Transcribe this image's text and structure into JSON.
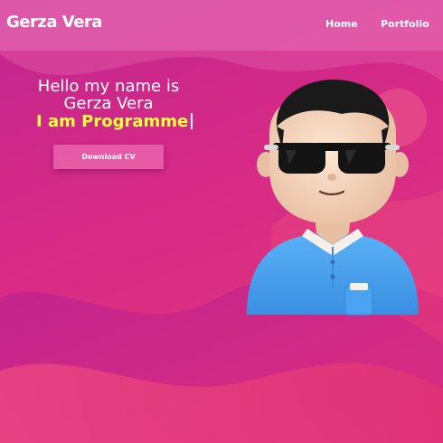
{
  "header": {
    "brand": "Gerza Vera",
    "nav": [
      {
        "label": "Home"
      },
      {
        "label": "Portfolio"
      }
    ]
  },
  "hero": {
    "greeting": "Hello my name is Gerza Vera",
    "role_text": "I am Programme",
    "download_label": "Download CV"
  },
  "colors": {
    "background_accent": "#d62a86",
    "role_text": "#f7ff3e",
    "shirt": "#4aa3f0"
  },
  "avatar": {
    "icon": "cartoon-avatar-sunglasses"
  }
}
